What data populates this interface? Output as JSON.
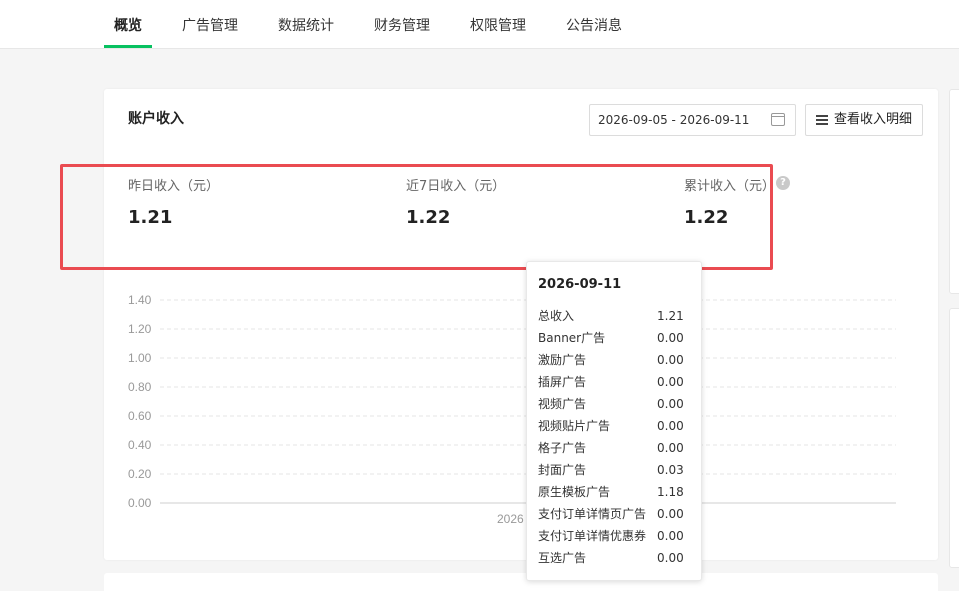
{
  "nav": {
    "tabs": [
      {
        "label": "概览",
        "active": true
      },
      {
        "label": "广告管理"
      },
      {
        "label": "数据统计"
      },
      {
        "label": "财务管理"
      },
      {
        "label": "权限管理"
      },
      {
        "label": "公告消息"
      }
    ],
    "accent_color": "#07c160"
  },
  "card": {
    "title": "账户收入",
    "date_range": "2026-09-05 - 2026-09-11",
    "detail_button": "查看收入明细",
    "stats": [
      {
        "label": "昨日收入（元）",
        "value": "1.21"
      },
      {
        "label": "近7日收入（元）",
        "value": "1.22"
      },
      {
        "label": "累计收入（元）",
        "value": "1.22"
      }
    ],
    "help_icon": "?",
    "highlight_color": "#ea4b51"
  },
  "chart_data": {
    "type": "line",
    "yticks": [
      "1.40",
      "1.20",
      "1.00",
      "0.80",
      "0.60",
      "0.40",
      "0.20",
      "0.00"
    ],
    "ylim": [
      0,
      1.4
    ],
    "x_partial_label": "2026",
    "grid": true
  },
  "tooltip": {
    "date": "2026-09-11",
    "rows": [
      {
        "name": "总收入",
        "value": "1.21"
      },
      {
        "name": "Banner广告",
        "value": "0.00"
      },
      {
        "name": "激励广告",
        "value": "0.00"
      },
      {
        "name": "插屏广告",
        "value": "0.00"
      },
      {
        "name": "视频广告",
        "value": "0.00"
      },
      {
        "name": "视频贴片广告",
        "value": "0.00"
      },
      {
        "name": "格子广告",
        "value": "0.00"
      },
      {
        "name": "封面广告",
        "value": "0.03"
      },
      {
        "name": "原生模板广告",
        "value": "1.18"
      },
      {
        "name": "支付订单详情页广告",
        "value": "0.00"
      },
      {
        "name": "支付订单详情优惠券",
        "value": "0.00"
      },
      {
        "name": "互选广告",
        "value": "0.00"
      }
    ]
  }
}
